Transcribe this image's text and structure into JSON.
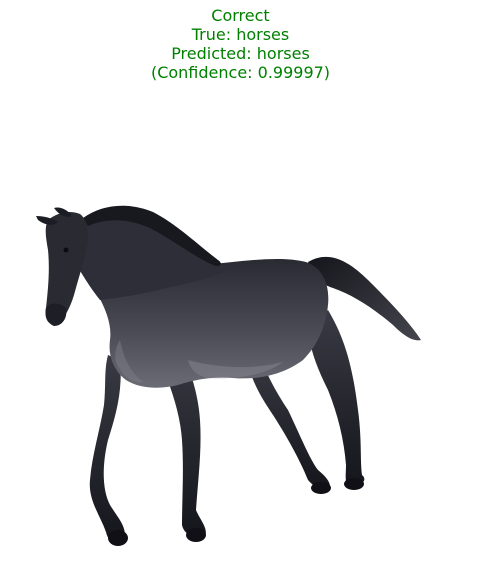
{
  "caption": {
    "status": "Correct",
    "true_label": "True: horses",
    "predicted_label": "Predicted: horses",
    "confidence": "(Confidence: 0.99997)"
  },
  "colors": {
    "caption_text": "#008000",
    "background": "#ffffff",
    "horse_body": "#3a3a44",
    "horse_shadow": "#1c1c24",
    "horse_highlight": "#6a6a74"
  },
  "image": {
    "subject": "horse-photo"
  }
}
